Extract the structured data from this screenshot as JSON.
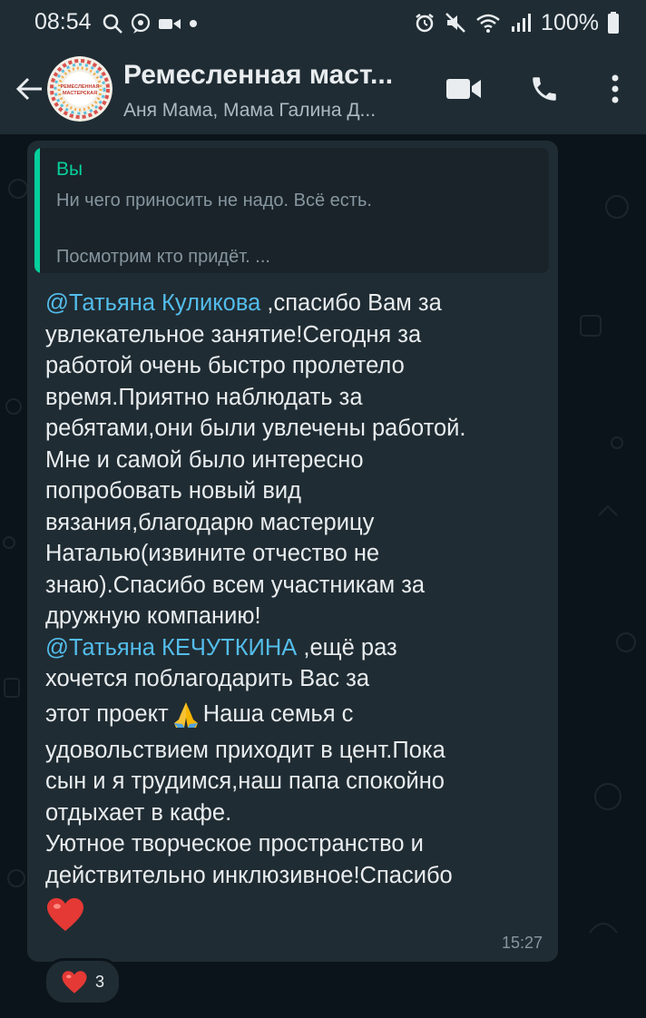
{
  "status_bar": {
    "time": "08:54",
    "battery": "100%",
    "left_icons": [
      "search-icon",
      "chat-bubble-icon",
      "media-icon",
      "dot-icon"
    ],
    "right_icons": [
      "alarm-icon",
      "mute-icon",
      "wifi-icon",
      "signal-icon",
      "battery-icon"
    ]
  },
  "header": {
    "title": "Ремесленная маст...",
    "subtitle": "Аня Мама, Мама Галина Д...",
    "avatar_text_top": "РЕМЕСЛЕННАЯ",
    "avatar_text_bottom": "МАСТЕРСКАЯ"
  },
  "message": {
    "quoted": {
      "author": "Вы",
      "line1": "Ни чего приносить не надо. Всё есть.",
      "line2": "Посмотрим кто придёт.  ..."
    },
    "lines": [
      {
        "mention": "@Татьяна Куликова",
        "text": " ,спасибо Вам за"
      },
      {
        "text": "увлекательное занятие!Сегодня за"
      },
      {
        "text": "работой очень  быстро пролетело"
      },
      {
        "text": "время.Приятно наблюдать за"
      },
      {
        "text": "ребятами,они были увлечены работой."
      },
      {
        "text": "Мне и самой  было интересно"
      },
      {
        "text": "попробовать новый вид"
      },
      {
        "text": "вязания,благодарю  мастерицу"
      },
      {
        "text": "Наталью(извините отчество не"
      },
      {
        "text": "знаю).Спасибо всем участникам  за"
      },
      {
        "text": "дружную компанию!"
      },
      {
        "mention": "@Татьяна КЕЧУТКИНА",
        "text": " ,ещё  раз"
      },
      {
        "text": "хочется  поблагодарить  Вас за"
      },
      {
        "text_before": "этот проект",
        "emoji": "pray-emoji",
        "text_after": " Наша семья  с"
      },
      {
        "text": "удовольствием  приходит в цент.Пока"
      },
      {
        "text": "сын и я трудимся,наш папа спокойно"
      },
      {
        "text": "отдыхает в кафе."
      },
      {
        "text": "Уютное творческое пространство и"
      },
      {
        "text": "действительно инклюзивное!Спасибо"
      }
    ],
    "end_emoji": "red-heart-emoji",
    "time": "15:27",
    "reaction": {
      "emoji": "red-heart-emoji",
      "count": "3"
    }
  },
  "colors": {
    "background": "#0b141a",
    "bar": "#1f2c34",
    "bubble": "#202c33",
    "mention": "#53bdeb",
    "quote_accent": "#06cf9c"
  }
}
